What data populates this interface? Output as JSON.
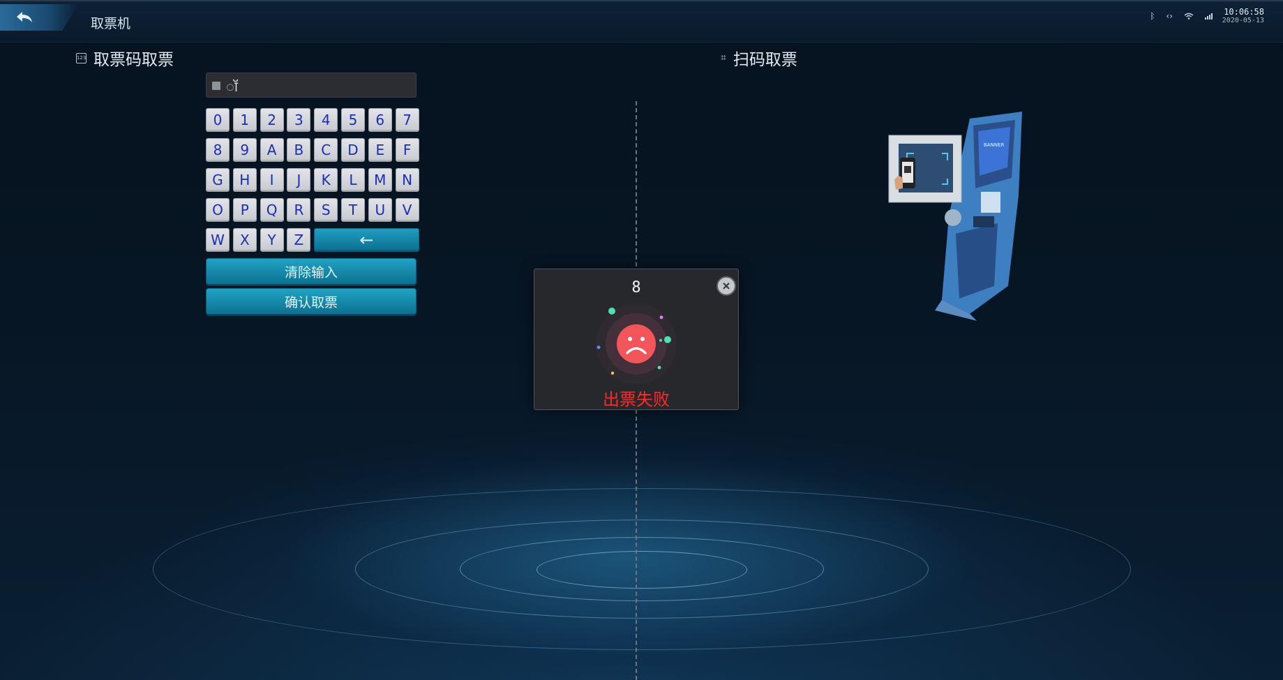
{
  "header": {
    "title": "取票机",
    "time": "10:06:58",
    "date": "2020-05-13"
  },
  "left": {
    "section_title": "取票码取票",
    "section_icon_text": "123",
    "input_value": "ॉ",
    "keys": [
      "0",
      "1",
      "2",
      "3",
      "4",
      "5",
      "6",
      "7",
      "8",
      "9",
      "A",
      "B",
      "C",
      "D",
      "E",
      "F",
      "G",
      "H",
      "I",
      "J",
      "K",
      "L",
      "M",
      "N",
      "O",
      "P",
      "Q",
      "R",
      "S",
      "T",
      "U",
      "V",
      "W",
      "X",
      "Y",
      "Z"
    ],
    "backspace_label": "←",
    "clear_label": "清除输入",
    "confirm_label": "确认取票"
  },
  "right": {
    "section_title": "扫码取票",
    "kiosk_screen_text": "BANNER"
  },
  "modal": {
    "countdown": "8",
    "message": "出票失败"
  },
  "colors": {
    "accent": "#1698bb",
    "error": "#ff2a2a",
    "key_text": "#1d2db8",
    "face": "#f2555a"
  }
}
